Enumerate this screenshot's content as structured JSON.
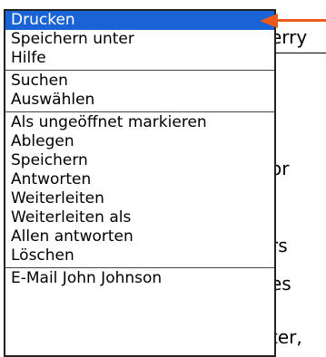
{
  "background": {
    "fragments": [
      "erry",
      "or",
      "rs",
      "es",
      "ter,"
    ]
  },
  "menu": {
    "items": [
      {
        "label": "Drucken",
        "selected": true
      },
      {
        "label": "Speichern unter"
      },
      {
        "label": "Hilfe"
      },
      {
        "label": "Suchen"
      },
      {
        "label": "Auswählen"
      },
      {
        "label": "Als ungeöffnet markieren"
      },
      {
        "label": "Ablegen"
      },
      {
        "label": "Speichern"
      },
      {
        "label": "Antworten"
      },
      {
        "label": "Weiterleiten"
      },
      {
        "label": "Weiterleiten als"
      },
      {
        "label": "Allen antworten"
      },
      {
        "label": "Löschen"
      },
      {
        "label": "E-Mail John Johnson"
      }
    ]
  },
  "colors": {
    "selection": "#1a63d6",
    "arrow": "#ea5a1a"
  }
}
